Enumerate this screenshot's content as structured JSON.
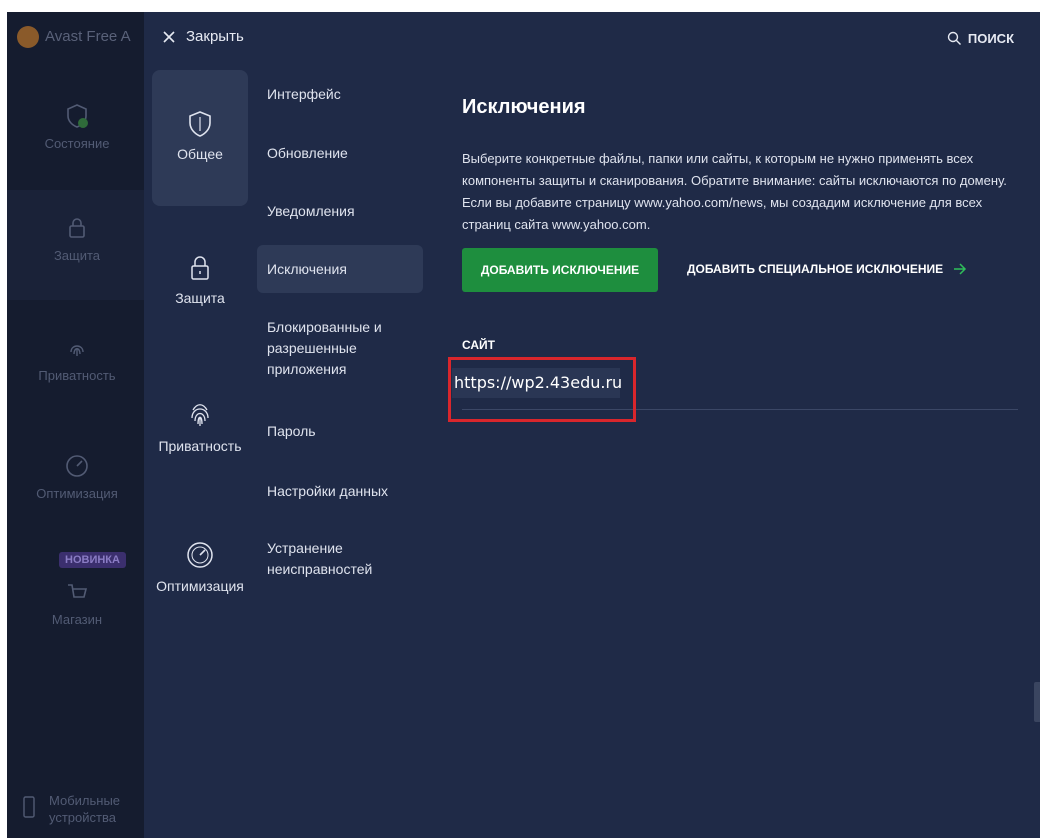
{
  "app": {
    "title": "Avast Free A",
    "nav": [
      {
        "label": "Состояние",
        "icon": "shield-check-icon"
      },
      {
        "label": "Защита",
        "icon": "lock-icon"
      },
      {
        "label": "Приватность",
        "icon": "fingerprint-icon"
      },
      {
        "label": "Оптимизация",
        "icon": "speedometer-icon"
      },
      {
        "label": "Магазин",
        "icon": "cart-icon",
        "badge": "НОВИНКА"
      },
      {
        "label": "Мобильные устройства",
        "icon": "phone-icon"
      }
    ]
  },
  "overlay": {
    "close_label": "Закрыть",
    "search_label": "ПОИСК",
    "categories": [
      {
        "label": "Общее",
        "icon": "shield-icon",
        "active": true
      },
      {
        "label": "Защита",
        "icon": "lock-icon"
      },
      {
        "label": "Приватность",
        "icon": "fingerprint-icon"
      },
      {
        "label": "Оптимизация",
        "icon": "speedometer-icon"
      }
    ],
    "subitems": [
      "Интерфейс",
      "Обновление",
      "Уведомления",
      "Исключения",
      "Блокированные и разрешенные приложения",
      "Пароль",
      "Настройки данных",
      "Устранение неисправностей"
    ],
    "active_subitem": "Исключения"
  },
  "content": {
    "title": "Исключения",
    "description": "Выберите конкретные файлы, папки или сайты, к которым не нужно применять всех компоненты защиты и сканирования. Обратите внимание: сайты исключаются по домену. Если вы добавите страницу www.yahoo.com/news, мы создадим исключение для всех страниц сайта www.yahoo.com.",
    "add_button": "ДОБАВИТЬ ИСКЛЮЧЕНИЕ",
    "add_special_button": "ДОБАВИТЬ СПЕЦИАЛЬНОЕ ИСКЛЮЧЕНИЕ",
    "column_header": "САЙТ",
    "sites": [
      "https://wp2.43edu.ru"
    ]
  },
  "colors": {
    "background": "#1f2a47",
    "sidebar": "#151c2f",
    "active_item": "#2e3a57",
    "accent_green": "#1e8e3e",
    "highlight_red": "#d9262c"
  }
}
